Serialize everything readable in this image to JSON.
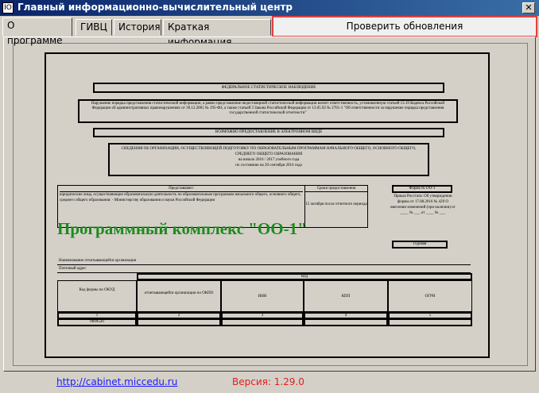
{
  "window": {
    "title": "Главный информационно-вычислительный центр",
    "icon_text": "IO",
    "close": "✕"
  },
  "tabs": [
    "О программе",
    "ГИВЦ",
    "История",
    "Краткая информация"
  ],
  "update_button": "Проверить обновления",
  "document": {
    "header1": "ФЕДЕРАЛЬНОЕ СТАТИСТИЧЕСКОЕ НАБЛЮДЕНИЕ",
    "notice": "Нарушение порядка представления статистической информации, а равно представление недостоверной статистической информации влечет ответственность, установленную статьей 13.19 Кодекса Российской Федерации об административных правонарушениях от 30.12.2001 № 195-ФЗ, а также статьей 3 Закона Российской Федерации от 13.05.92 № 2761-1 \"Об ответственности за нарушение порядка представления государственной статистической отчетности\"",
    "electronic": "ВОЗМОЖНО ПРЕДОСТАВЛЕНИЕ В ЭЛЕКТРОННОМ ВИДЕ",
    "subject": "СВЕДЕНИЯ ОБ ОРГАНИЗАЦИИ, ОСУЩЕСТВЛЯЮЩЕЙ ПОДГОТОВКУ ПО ОБРАЗОВАТЕЛЬНЫМ ПРОГРАММАМ НАЧАЛЬНОГО ОБЩЕГО, ОСНОВНОГО ОБЩЕГО, СРЕДНЕГО ОБЩЕГО ОБРАЗОВАНИЯ",
    "period": "на начало 2016 / 2017 учебного года",
    "date_line": "по состоянию на 20 сентября 2016 года",
    "presenters_head": "Представляют:",
    "presenters_text": "юридические лица, осуществляющие образовательную деятельность по образовательным программам начального общего, основного общего, среднего общего образования: - Министерству образования и науки Российской Федерации",
    "deadline_head": "Сроки предоставления",
    "deadline_text": "15 октября после отчетного периода",
    "form_head": "Форма № ОО-1",
    "form_text": "Приказ Росстата: Об утверждении формы от 17.08.2016 № 429 О внесении изменений (при наличии) от ____ № ___ от ____ № ___",
    "form_period": "Годовая",
    "product_name": "Программный комплекс \"ОО-1\"",
    "org_name": "Наименование отчитывающейся организации",
    "address": "Почтовый адрес",
    "code_head": "Код",
    "col1": "Код формы по ОКУД",
    "col2": "отчитывающейся организации по ОКПО",
    "col3": "ИНН",
    "col4": "КПП",
    "col5": "ОГРН",
    "nums": [
      "1",
      "2",
      "3",
      "4",
      "5"
    ],
    "okud": "0609520"
  },
  "footer": {
    "link": "http://cabinet.miccedu.ru",
    "version": "Версия: 1.29.0"
  }
}
